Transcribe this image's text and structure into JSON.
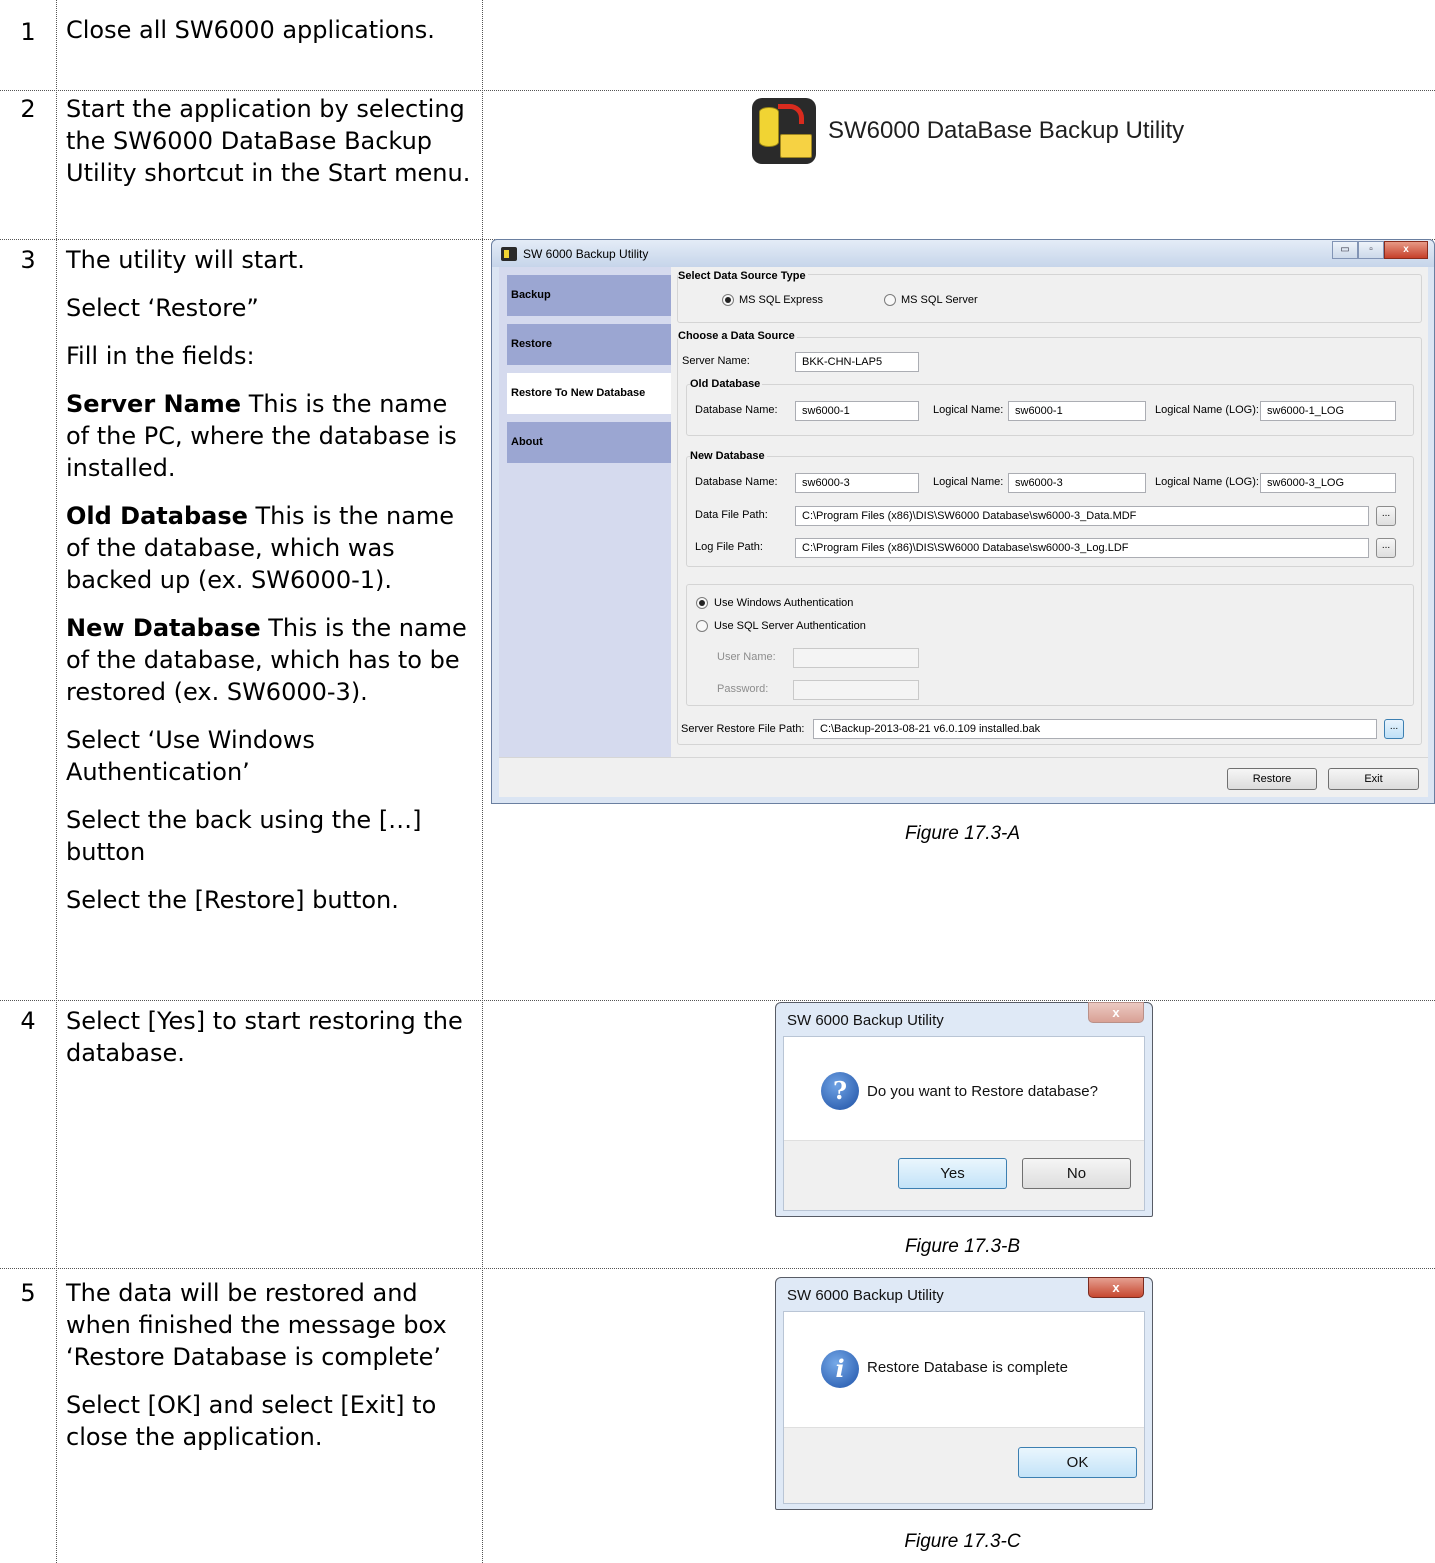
{
  "steps": [
    {
      "num": "1",
      "paras": [
        "Close all SW6000 applications."
      ]
    },
    {
      "num": "2",
      "paras": [
        "Start the application by selecting the SW6000 DataBase Backup Utility shortcut in the Start menu."
      ]
    },
    {
      "num": "3",
      "paras": [
        "The utility will start.",
        "Select ‘Restore”",
        "Fill in the fields:",
        {
          "bold": "Server Name",
          "rest": " This is the name of the PC, where the database is installed."
        },
        {
          "bold": "Old Database",
          "rest": " This is the name of the database, which was backed up (ex. SW6000-1)."
        },
        {
          "bold": "New Database",
          "rest": " This is the name of the database, which has to be restored (ex. SW6000-3)."
        },
        "Select ‘Use Windows Authentication’",
        "Select the back using the […] button",
        "Select the [Restore] button."
      ]
    },
    {
      "num": "4",
      "paras": [
        "Select [Yes] to start restoring the database."
      ]
    },
    {
      "num": "5",
      "paras": [
        "The data will be restored and when finished the message box ‘Restore Database is complete’",
        "Select [OK] and select [Exit] to close the application."
      ]
    }
  ],
  "shortcut": {
    "label": "SW6000 DataBase Backup Utility",
    "icon": "database-backup-icon"
  },
  "app": {
    "title": "SW 6000 Backup Utility",
    "nav": [
      "Backup",
      "Restore",
      "Restore To New Database",
      "About"
    ],
    "active_nav": "Restore To New Database",
    "source_type": {
      "legend": "Select Data Source Type",
      "options": [
        "MS SQL Express",
        "MS SQL Server"
      ],
      "selected": "MS SQL Express"
    },
    "data_source": {
      "legend": "Choose a Data Source",
      "server_label": "Server Name:",
      "server_value": "BKK-CHN-LAP5"
    },
    "old_db": {
      "legend": "Old Database",
      "db_name_label": "Database Name:",
      "db_name": "sw6000-1",
      "logical_label": "Logical Name:",
      "logical": "sw6000-1",
      "logical_log_label": "Logical Name (LOG):",
      "logical_log": "sw6000-1_LOG"
    },
    "new_db": {
      "legend": "New Database",
      "db_name_label": "Database Name:",
      "db_name": "sw6000-3",
      "logical_label": "Logical Name:",
      "logical": "sw6000-3",
      "logical_log_label": "Logical Name (LOG):",
      "logical_log": "sw6000-3_LOG",
      "data_path_label": "Data File Path:",
      "data_path": "C:\\Program Files (x86)\\DIS\\SW6000 Database\\sw6000-3_Data.MDF",
      "log_path_label": "Log File Path:",
      "log_path": "C:\\Program Files (x86)\\DIS\\SW6000 Database\\sw6000-3_Log.LDF"
    },
    "auth": {
      "options": [
        "Use Windows Authentication",
        "Use SQL Server Authentication"
      ],
      "selected": "Use Windows Authentication",
      "user_label": "User Name:",
      "password_label": "Password:"
    },
    "restore_path_label": "Server Restore File Path:",
    "restore_path": "C:\\Backup-2013-08-21 v6.0.109 installed.bak",
    "browse_label": "...",
    "restore_button": "Restore",
    "exit_button": "Exit"
  },
  "dialog_confirm": {
    "title": "SW 6000 Backup Utility",
    "message": "Do you want to Restore database?",
    "icon": "question-icon",
    "yes": "Yes",
    "no": "No"
  },
  "dialog_info": {
    "title": "SW 6000 Backup Utility",
    "message": "Restore Database is complete",
    "icon": "information-icon",
    "ok": "OK"
  },
  "captions": [
    "Figure 17.3-A",
    "Figure 17.3-B",
    "Figure 17.3-C"
  ],
  "glyphs": {
    "close": "x",
    "minimize": "▭",
    "maximize": "▫",
    "question": "?",
    "info": "i"
  }
}
